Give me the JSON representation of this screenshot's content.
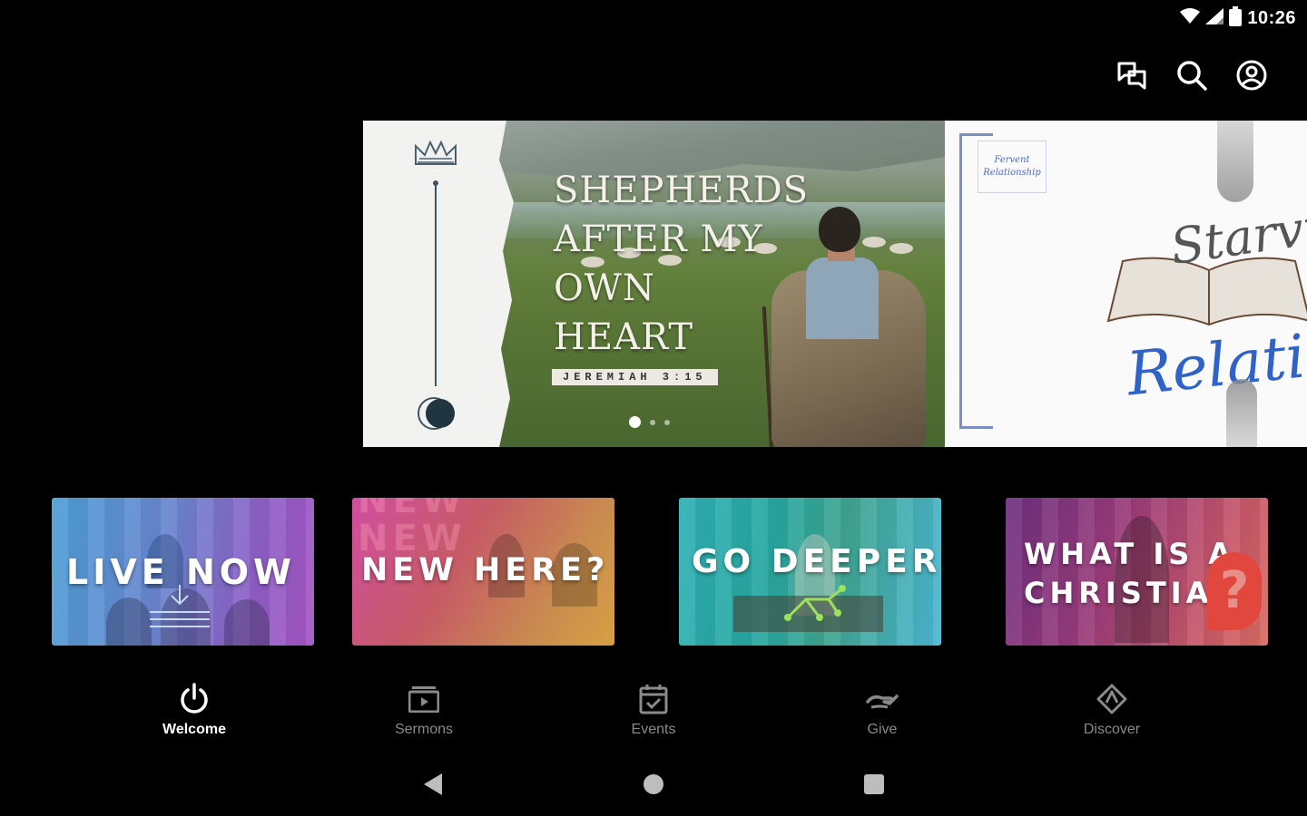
{
  "status_bar": {
    "time": "10:26",
    "icons": [
      "wifi-icon",
      "signal-icon",
      "battery-icon"
    ]
  },
  "top_actions": [
    {
      "name": "chat-button",
      "icon": "chat-bubbles-icon"
    },
    {
      "name": "search-button",
      "icon": "search-icon"
    },
    {
      "name": "profile-button",
      "icon": "account-circle-icon"
    }
  ],
  "carousel": {
    "slides": [
      {
        "title_lines": [
          "SHEPHERDS",
          "AFTER MY",
          "OWN",
          "HEART"
        ],
        "reference": "JEREMIAH 3:15"
      },
      {
        "stamp_lines": [
          "Fervent",
          "Relationship"
        ],
        "script_top": "Starving",
        "script_bottom": "Relationshi"
      }
    ],
    "page_count": 3,
    "active_page": 1
  },
  "tiles": [
    {
      "label": "LIVE NOW"
    },
    {
      "label": "NEW HERE?",
      "background_text": "NEW"
    },
    {
      "label": "GO DEEPER"
    },
    {
      "label_lines": [
        "WHAT IS A",
        "CHRISTIAN"
      ],
      "mark": "?"
    }
  ],
  "bottom_nav": {
    "items": [
      {
        "label": "Welcome",
        "icon": "power-icon",
        "active": true
      },
      {
        "label": "Sermons",
        "icon": "video-library-icon",
        "active": false
      },
      {
        "label": "Events",
        "icon": "calendar-check-icon",
        "active": false
      },
      {
        "label": "Give",
        "icon": "giving-hand-icon",
        "active": false
      },
      {
        "label": "Discover",
        "icon": "discover-icon",
        "active": false
      }
    ]
  },
  "system_nav": [
    "back-icon",
    "home-icon",
    "recents-icon"
  ],
  "colors": {
    "background": "#000000",
    "nav_active": "#ffffff",
    "nav_inactive": "#8a8a8a",
    "accent_blue": "#2f63c7"
  }
}
